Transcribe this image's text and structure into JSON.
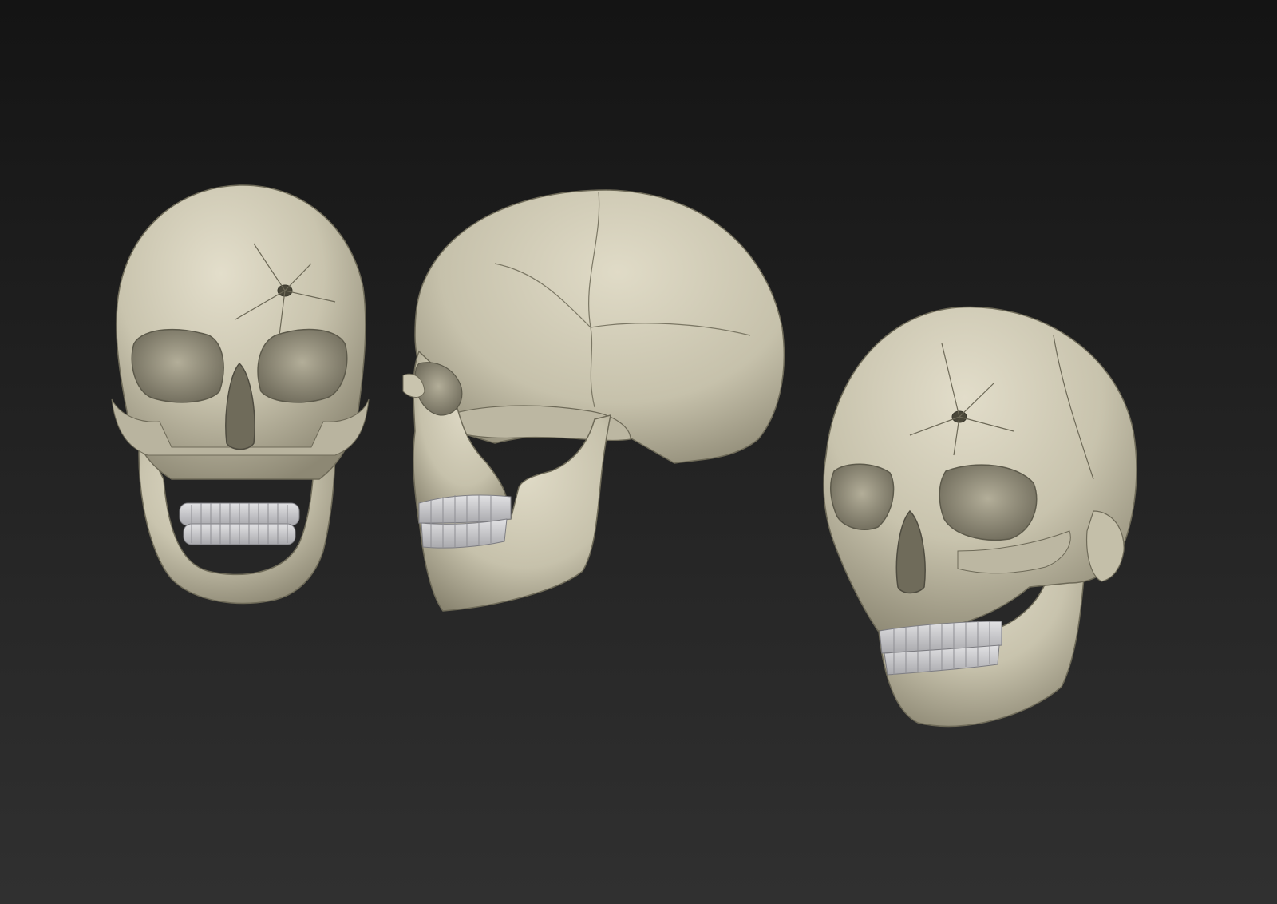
{
  "scene": {
    "colors": {
      "background_top": "#141414",
      "background_bottom": "#303030",
      "bone": "#cdc8b3",
      "bone_shadow": "#8f8a77",
      "teeth": "#c9c9cc"
    },
    "objects": [
      {
        "name": "skull-front-view",
        "view": "front"
      },
      {
        "name": "skull-side-view",
        "view": "side"
      },
      {
        "name": "skull-three-quarter-view",
        "view": "three-quarter"
      }
    ]
  }
}
